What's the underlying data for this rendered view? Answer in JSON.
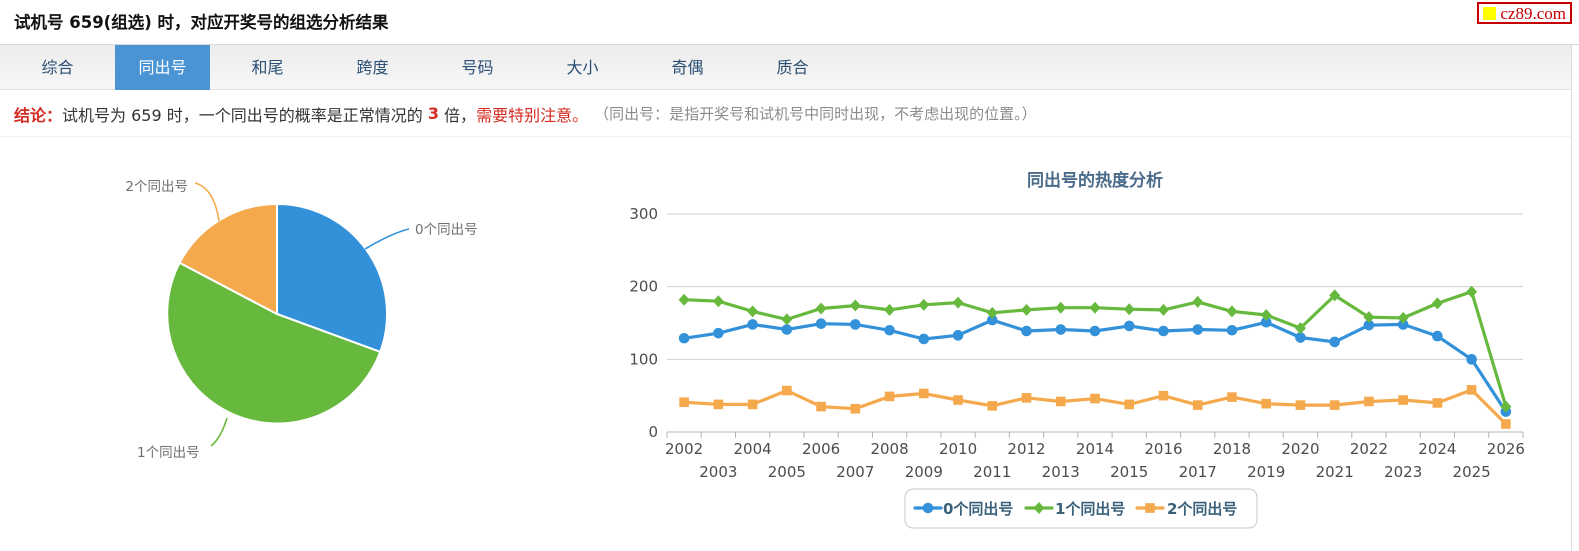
{
  "page": {
    "title": "试机号 659(组选) 时，对应开奖号的组选分析结果",
    "logo_text": "cz89.com"
  },
  "tabs": [
    {
      "label": "综合",
      "active": false
    },
    {
      "label": "同出号",
      "active": true
    },
    {
      "label": "和尾",
      "active": false
    },
    {
      "label": "跨度",
      "active": false
    },
    {
      "label": "号码",
      "active": false
    },
    {
      "label": "大小",
      "active": false
    },
    {
      "label": "奇偶",
      "active": false
    },
    {
      "label": "质合",
      "active": false
    }
  ],
  "conclusion": {
    "prefix": "结论：",
    "part1": "试机号为 659 时，一个同出号的概率是正常情况的 ",
    "multiplier": "3",
    "part2": " 倍，",
    "warning": "需要特别注意。",
    "note": "（同出号：是指开奖号和试机号中同时出现，不考虑出现的位置。）"
  },
  "colors": {
    "series_blue": "#3291d9",
    "series_green": "#67b93e",
    "series_orange": "#f5a94d",
    "tab_active_bg": "#4a94d4",
    "red_text": "#d42b22",
    "chart_title": "#4a6b8a",
    "axis_label": "#4c4c4c",
    "gridline": "#cfcfcf",
    "axis_line": "#b4b4b4",
    "pie_label": "#6f6f6f",
    "legend_text": "#3a607a",
    "legend_border": "#c8c8c8"
  },
  "chart_data": [
    {
      "type": "pie",
      "labels": [
        "0个同出号",
        "1个同出号",
        "2个同出号"
      ],
      "values_percent": [
        30.6,
        52.1,
        17.3
      ],
      "colors": [
        "#3291d9",
        "#67b93e",
        "#f5a94d"
      ],
      "start": "top, clockwise",
      "legend_position": "none (callout labels)"
    },
    {
      "type": "line",
      "title": "同出号的热度分析",
      "x": [
        2002,
        2003,
        2004,
        2005,
        2006,
        2007,
        2008,
        2009,
        2010,
        2011,
        2012,
        2013,
        2014,
        2015,
        2016,
        2017,
        2018,
        2019,
        2020,
        2021,
        2022,
        2023,
        2024,
        2025,
        2026
      ],
      "series": [
        {
          "name": "0个同出号",
          "color": "#3291d9",
          "marker": "circle",
          "values": [
            129,
            136,
            148,
            141,
            149,
            148,
            140,
            128,
            133,
            154,
            139,
            141,
            139,
            146,
            139,
            141,
            140,
            151,
            130,
            124,
            147,
            148,
            132,
            100,
            28
          ]
        },
        {
          "name": "1个同出号",
          "color": "#67b93e",
          "marker": "diamond",
          "values": [
            182,
            180,
            166,
            155,
            170,
            174,
            168,
            175,
            178,
            164,
            168,
            171,
            171,
            169,
            168,
            179,
            166,
            161,
            143,
            188,
            158,
            157,
            177,
            193,
            35
          ]
        },
        {
          "name": "2个同出号",
          "color": "#f5a94d",
          "marker": "square",
          "values": [
            41,
            38,
            38,
            57,
            35,
            32,
            49,
            53,
            44,
            36,
            47,
            42,
            46,
            38,
            50,
            37,
            48,
            39,
            37,
            37,
            42,
            44,
            40,
            58,
            11
          ]
        }
      ],
      "ylim": [
        0,
        300
      ],
      "yticks": [
        0,
        100,
        200,
        300
      ],
      "grid": true,
      "legend_position": "bottom",
      "xlabel": "",
      "ylabel": ""
    }
  ]
}
